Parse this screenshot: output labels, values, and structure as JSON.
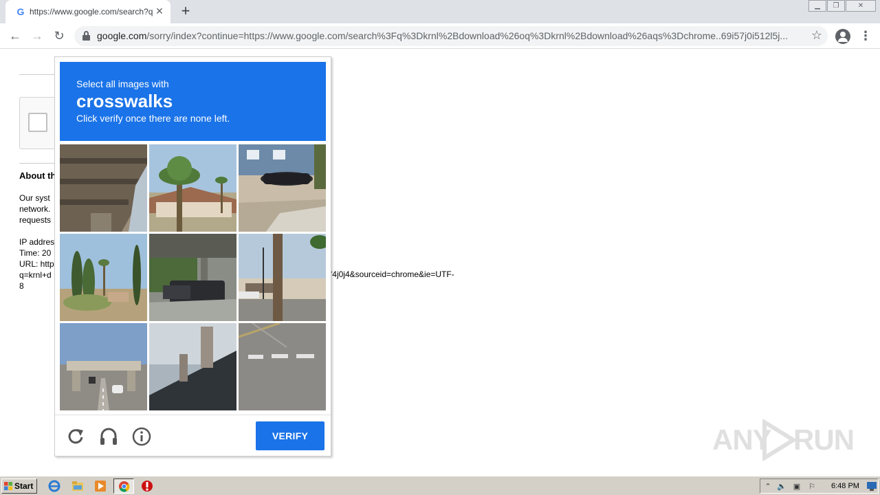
{
  "browser": {
    "tab_title": "https://www.google.com/search?q=",
    "tab_favicon": "G",
    "new_tab": "+",
    "url_host": "google.com",
    "url_path": "/sorry/index?continue=https://www.google.com/search%3Fq%3Dkrnl%2Bdownload%26oq%3Dkrnl%2Bdownload%26aqs%3Dchrome..69i57j0i512l5j..."
  },
  "page": {
    "about_heading": "About th",
    "lines": [
      "Our syst",
      "network.",
      "requests"
    ],
    "meta_lines": [
      "IP addres",
      "Time: 20",
      "URL: http",
      "q=krnl+d",
      "8"
    ],
    "url_tail": "'4j0j4&sourceid=chrome&ie=UTF-"
  },
  "captcha": {
    "instruction_prefix": "Select all images with",
    "target": "crosswalks",
    "instruction_suffix": "Click verify once there are none left.",
    "verify_label": "VERIFY",
    "tiles": [
      "overpass-underside",
      "palm-tree-house",
      "parked-car-house",
      "cypress-trees",
      "truck-under-bridge",
      "palm-trunk-street",
      "highway-overpass",
      "rooftop-chimney",
      "crosswalk-road"
    ]
  },
  "watermark": {
    "any": "ANY",
    "run": "RUN"
  },
  "taskbar": {
    "start_label": "Start",
    "clock": "6:48 PM"
  },
  "colors": {
    "captcha_blue": "#1a73e8",
    "taskbar": "#d4d0c8"
  }
}
